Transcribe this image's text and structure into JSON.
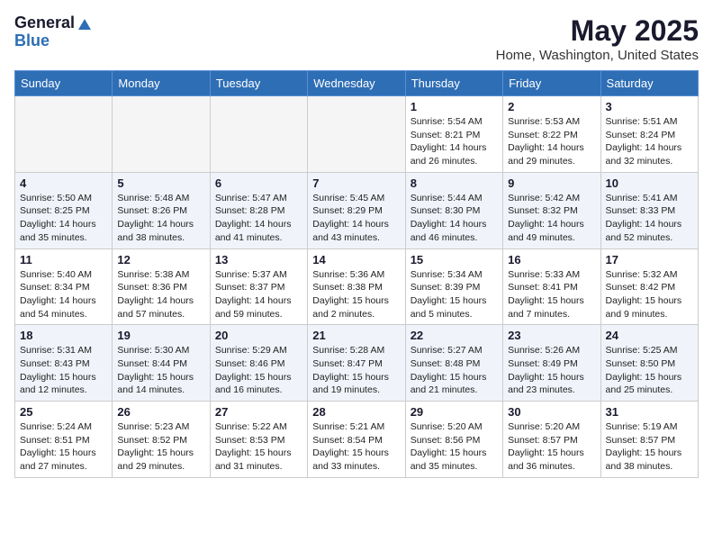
{
  "header": {
    "logo_general": "General",
    "logo_blue": "Blue",
    "month_title": "May 2025",
    "location": "Home, Washington, United States"
  },
  "weekdays": [
    "Sunday",
    "Monday",
    "Tuesday",
    "Wednesday",
    "Thursday",
    "Friday",
    "Saturday"
  ],
  "weeks": [
    [
      {
        "day": "",
        "empty": true
      },
      {
        "day": "",
        "empty": true
      },
      {
        "day": "",
        "empty": true
      },
      {
        "day": "",
        "empty": true
      },
      {
        "day": "1",
        "rise": "5:54 AM",
        "set": "8:21 PM",
        "daylight": "14 hours and 26 minutes."
      },
      {
        "day": "2",
        "rise": "5:53 AM",
        "set": "8:22 PM",
        "daylight": "14 hours and 29 minutes."
      },
      {
        "day": "3",
        "rise": "5:51 AM",
        "set": "8:24 PM",
        "daylight": "14 hours and 32 minutes."
      }
    ],
    [
      {
        "day": "4",
        "rise": "5:50 AM",
        "set": "8:25 PM",
        "daylight": "14 hours and 35 minutes."
      },
      {
        "day": "5",
        "rise": "5:48 AM",
        "set": "8:26 PM",
        "daylight": "14 hours and 38 minutes."
      },
      {
        "day": "6",
        "rise": "5:47 AM",
        "set": "8:28 PM",
        "daylight": "14 hours and 41 minutes."
      },
      {
        "day": "7",
        "rise": "5:45 AM",
        "set": "8:29 PM",
        "daylight": "14 hours and 43 minutes."
      },
      {
        "day": "8",
        "rise": "5:44 AM",
        "set": "8:30 PM",
        "daylight": "14 hours and 46 minutes."
      },
      {
        "day": "9",
        "rise": "5:42 AM",
        "set": "8:32 PM",
        "daylight": "14 hours and 49 minutes."
      },
      {
        "day": "10",
        "rise": "5:41 AM",
        "set": "8:33 PM",
        "daylight": "14 hours and 52 minutes."
      }
    ],
    [
      {
        "day": "11",
        "rise": "5:40 AM",
        "set": "8:34 PM",
        "daylight": "14 hours and 54 minutes."
      },
      {
        "day": "12",
        "rise": "5:38 AM",
        "set": "8:36 PM",
        "daylight": "14 hours and 57 minutes."
      },
      {
        "day": "13",
        "rise": "5:37 AM",
        "set": "8:37 PM",
        "daylight": "14 hours and 59 minutes."
      },
      {
        "day": "14",
        "rise": "5:36 AM",
        "set": "8:38 PM",
        "daylight": "15 hours and 2 minutes."
      },
      {
        "day": "15",
        "rise": "5:34 AM",
        "set": "8:39 PM",
        "daylight": "15 hours and 5 minutes."
      },
      {
        "day": "16",
        "rise": "5:33 AM",
        "set": "8:41 PM",
        "daylight": "15 hours and 7 minutes."
      },
      {
        "day": "17",
        "rise": "5:32 AM",
        "set": "8:42 PM",
        "daylight": "15 hours and 9 minutes."
      }
    ],
    [
      {
        "day": "18",
        "rise": "5:31 AM",
        "set": "8:43 PM",
        "daylight": "15 hours and 12 minutes."
      },
      {
        "day": "19",
        "rise": "5:30 AM",
        "set": "8:44 PM",
        "daylight": "15 hours and 14 minutes."
      },
      {
        "day": "20",
        "rise": "5:29 AM",
        "set": "8:46 PM",
        "daylight": "15 hours and 16 minutes."
      },
      {
        "day": "21",
        "rise": "5:28 AM",
        "set": "8:47 PM",
        "daylight": "15 hours and 19 minutes."
      },
      {
        "day": "22",
        "rise": "5:27 AM",
        "set": "8:48 PM",
        "daylight": "15 hours and 21 minutes."
      },
      {
        "day": "23",
        "rise": "5:26 AM",
        "set": "8:49 PM",
        "daylight": "15 hours and 23 minutes."
      },
      {
        "day": "24",
        "rise": "5:25 AM",
        "set": "8:50 PM",
        "daylight": "15 hours and 25 minutes."
      }
    ],
    [
      {
        "day": "25",
        "rise": "5:24 AM",
        "set": "8:51 PM",
        "daylight": "15 hours and 27 minutes."
      },
      {
        "day": "26",
        "rise": "5:23 AM",
        "set": "8:52 PM",
        "daylight": "15 hours and 29 minutes."
      },
      {
        "day": "27",
        "rise": "5:22 AM",
        "set": "8:53 PM",
        "daylight": "15 hours and 31 minutes."
      },
      {
        "day": "28",
        "rise": "5:21 AM",
        "set": "8:54 PM",
        "daylight": "15 hours and 33 minutes."
      },
      {
        "day": "29",
        "rise": "5:20 AM",
        "set": "8:56 PM",
        "daylight": "15 hours and 35 minutes."
      },
      {
        "day": "30",
        "rise": "5:20 AM",
        "set": "8:57 PM",
        "daylight": "15 hours and 36 minutes."
      },
      {
        "day": "31",
        "rise": "5:19 AM",
        "set": "8:57 PM",
        "daylight": "15 hours and 38 minutes."
      }
    ]
  ],
  "labels": {
    "sunrise": "Sunrise:",
    "sunset": "Sunset:",
    "daylight": "Daylight:"
  }
}
